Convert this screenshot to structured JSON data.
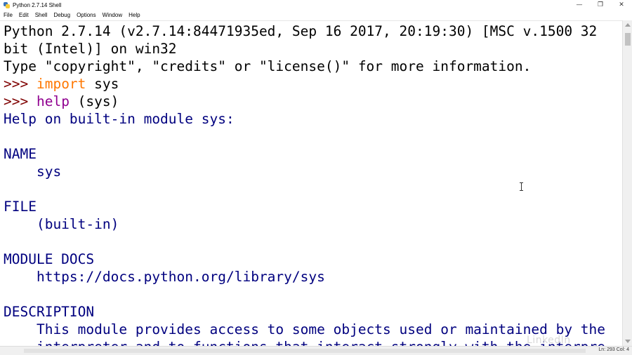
{
  "window": {
    "title": "Python 2.7.14 Shell",
    "controls": {
      "minimize": "—",
      "restore": "❐",
      "close": "✕"
    }
  },
  "menu": [
    "File",
    "Edit",
    "Shell",
    "Debug",
    "Options",
    "Window",
    "Help"
  ],
  "shell": {
    "banner_1": "Python 2.7.14 (v2.7.14:84471935ed, Sep 16 2017, 20:19:30) [MSC v.1500 32",
    "banner_2": "bit (Intel)] on win32",
    "banner_3": "Type \"copyright\", \"credits\" or \"license()\" for more information.",
    "prompt": ">>> ",
    "cmd1_kw": "import",
    "cmd1_rest": " sys",
    "cmd2_fn": "help",
    "cmd2_rest": " (sys)",
    "help_header": "Help on built-in module sys:",
    "name_heading": "NAME",
    "name_value": "    sys",
    "file_heading": "FILE",
    "file_value": "    (built-in)",
    "docs_heading": "MODULE DOCS",
    "docs_value": "    https://docs.python.org/library/sys",
    "desc_heading": "DESCRIPTION",
    "desc_line1": "    This module provides access to some objects used or maintained by the",
    "desc_line2": "    interpreter and to functions that interact strongly with the interpre"
  },
  "status": {
    "position": "Ln: 293   Col: 4"
  },
  "watermark": "LinkedIn",
  "colors": {
    "output": "#00007f",
    "prompt": "#7f0000",
    "keyword": "#ff7700",
    "builtin": "#900090"
  }
}
